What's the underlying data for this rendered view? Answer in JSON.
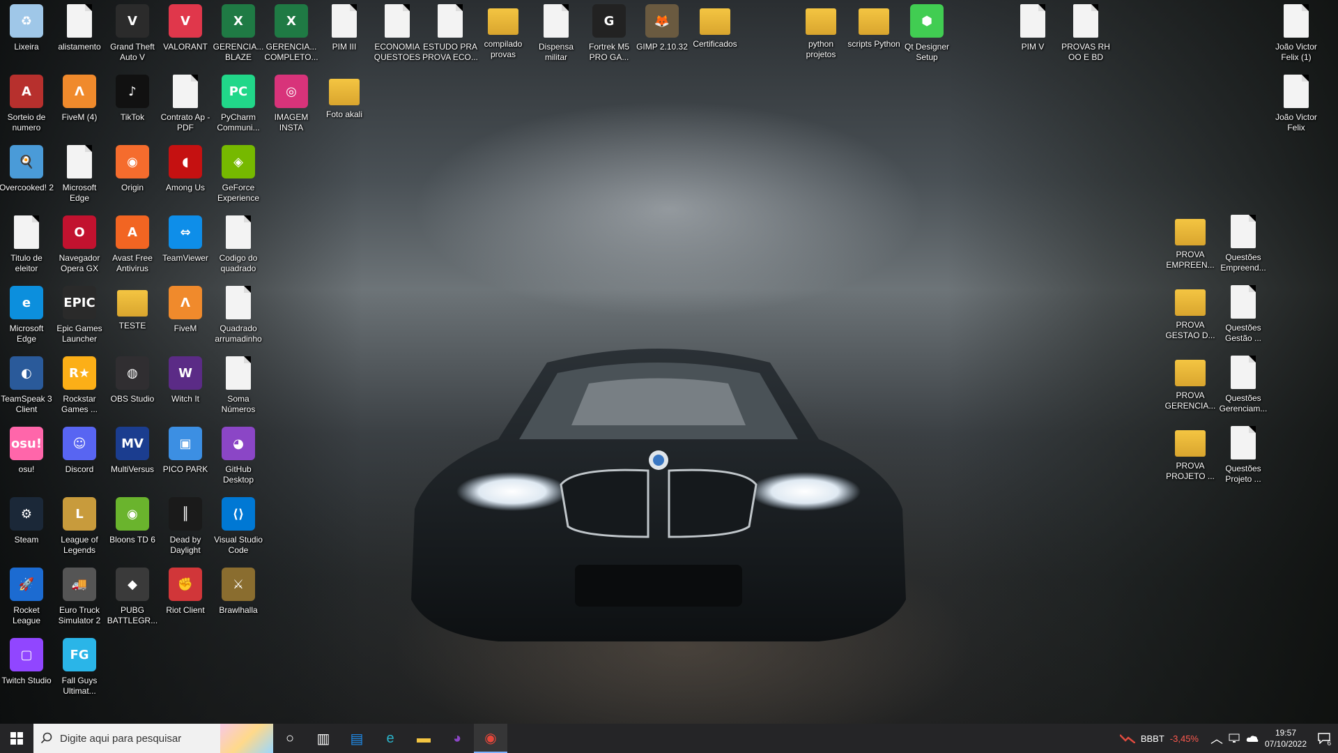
{
  "desktop": {
    "icons_left": [
      {
        "label": "Lixeira",
        "icon": "recycle-bin-icon",
        "type": "app",
        "color": "#9fc7e8"
      },
      {
        "label": "alistamento",
        "icon": "document-icon",
        "type": "doc",
        "color": "#f3f3f3"
      },
      {
        "label": "Grand Theft Auto V",
        "icon": "gta-v-icon",
        "type": "app",
        "color": "#2b2b2b"
      },
      {
        "label": "VALORANT",
        "icon": "valorant-icon",
        "type": "app",
        "color": "#e0374b"
      },
      {
        "label": "GERENCIA... BLAZE",
        "icon": "excel-icon",
        "type": "app",
        "color": "#1f7a44"
      },
      {
        "label": "GERENCIA... COMPLETO...",
        "icon": "excel-icon",
        "type": "app",
        "color": "#1f7a44"
      },
      {
        "label": "PIM III",
        "icon": "document-icon",
        "type": "doc",
        "color": "#f3f3f3"
      },
      {
        "label": "ECONOMIA QUESTOES",
        "icon": "document-icon",
        "type": "doc",
        "color": "#f3f3f3"
      },
      {
        "label": "ESTUDO PRA PROVA ECO...",
        "icon": "document-icon",
        "type": "doc",
        "color": "#f3f3f3"
      },
      {
        "label": "compilado provas",
        "icon": "folder-icon",
        "type": "folder",
        "color": "#f4c542"
      },
      {
        "label": "Dispensa militar",
        "icon": "document-icon",
        "type": "doc",
        "color": "#f3f3f3"
      },
      {
        "label": "Fortrek M5 PRO GA...",
        "icon": "fortrek-icon",
        "type": "app",
        "color": "#222222"
      },
      {
        "label": "GIMP 2.10.32",
        "icon": "gimp-icon",
        "type": "app",
        "color": "#6a5a40"
      },
      {
        "label": "Certificados",
        "icon": "folder-icon",
        "type": "folder",
        "color": "#f4c542"
      },
      {
        "label": "Sorteio de numero",
        "icon": "access-icon",
        "type": "app",
        "color": "#b7302d"
      },
      {
        "label": "FiveM (4)",
        "icon": "fivem-icon",
        "type": "app",
        "color": "#f08a2c"
      },
      {
        "label": "TikTok",
        "icon": "tiktok-icon",
        "type": "app",
        "color": "#111111"
      },
      {
        "label": "Contrato Ap - PDF",
        "icon": "document-icon",
        "type": "doc",
        "color": "#f3f3f3"
      },
      {
        "label": "PyCharm Communi...",
        "icon": "pycharm-icon",
        "type": "app",
        "color": "#21d789"
      },
      {
        "label": "IMAGEM INSTA",
        "icon": "instagram-icon",
        "type": "app",
        "color": "#d8337a"
      },
      {
        "label": "Foto akali",
        "icon": "folder-icon",
        "type": "folder",
        "color": "#f4c542"
      },
      {
        "label": "Overcooked! 2",
        "icon": "overcooked-icon",
        "type": "app",
        "color": "#4a9bd8"
      },
      {
        "label": "Microsoft Edge",
        "icon": "document-icon",
        "type": "doc",
        "color": "#f3f3f3"
      },
      {
        "label": "Origin",
        "icon": "origin-icon",
        "type": "app",
        "color": "#f56c2d"
      },
      {
        "label": "Among Us",
        "icon": "among-us-icon",
        "type": "app",
        "color": "#c51111"
      },
      {
        "label": "GeForce Experience",
        "icon": "nvidia-icon",
        "type": "app",
        "color": "#76b900"
      },
      {
        "label": "Titulo de eleitor",
        "icon": "word-doc-icon",
        "type": "doc",
        "color": "#f3f3f3"
      },
      {
        "label": "Navegador Opera GX",
        "icon": "opera-gx-icon",
        "type": "app",
        "color": "#c2122f"
      },
      {
        "label": "Avast Free Antivirus",
        "icon": "avast-icon",
        "type": "app",
        "color": "#f26522"
      },
      {
        "label": "TeamViewer",
        "icon": "teamviewer-icon",
        "type": "app",
        "color": "#0e8ee9"
      },
      {
        "label": "Codigo do quadrado",
        "icon": "document-icon",
        "type": "doc",
        "color": "#f3f3f3"
      },
      {
        "label": "Microsoft Edge",
        "icon": "edge-icon",
        "type": "app",
        "color": "#0c8fdd"
      },
      {
        "label": "Epic Games Launcher",
        "icon": "epic-games-icon",
        "type": "app",
        "color": "#2a2a2a"
      },
      {
        "label": "TESTE",
        "icon": "chrome-folder-icon",
        "type": "folder",
        "color": "#f4c542"
      },
      {
        "label": "FiveM",
        "icon": "fivem-icon",
        "type": "app",
        "color": "#f08a2c"
      },
      {
        "label": "Quadrado arrumadinho",
        "icon": "document-icon",
        "type": "doc",
        "color": "#f3f3f3"
      },
      {
        "label": "TeamSpeak 3 Client",
        "icon": "teamspeak-icon",
        "type": "app",
        "color": "#2a5a9a"
      },
      {
        "label": "Rockstar Games ...",
        "icon": "rockstar-icon",
        "type": "app",
        "color": "#fcaf17"
      },
      {
        "label": "OBS Studio",
        "icon": "obs-icon",
        "type": "app",
        "color": "#302e31"
      },
      {
        "label": "Witch It",
        "icon": "witch-it-icon",
        "type": "app",
        "color": "#5b2b86"
      },
      {
        "label": "Soma Números",
        "icon": "document-icon",
        "type": "doc",
        "color": "#f3f3f3"
      },
      {
        "label": "osu!",
        "icon": "osu-icon",
        "type": "app",
        "color": "#ff66aa"
      },
      {
        "label": "Discord",
        "icon": "discord-icon",
        "type": "app",
        "color": "#5865f2"
      },
      {
        "label": "MultiVersus",
        "icon": "multiversus-icon",
        "type": "app",
        "color": "#1b3d8f"
      },
      {
        "label": "PICO PARK",
        "icon": "pico-park-icon",
        "type": "app",
        "color": "#3c8fe3"
      },
      {
        "label": "GitHub Desktop",
        "icon": "github-icon",
        "type": "app",
        "color": "#8b46c6"
      },
      {
        "label": "Steam",
        "icon": "steam-icon",
        "type": "app",
        "color": "#1b2838"
      },
      {
        "label": "League of Legends",
        "icon": "league-icon",
        "type": "app",
        "color": "#c89b3c"
      },
      {
        "label": "Bloons TD 6",
        "icon": "bloons-icon",
        "type": "app",
        "color": "#6ab42d"
      },
      {
        "label": "Dead by Daylight",
        "icon": "dbd-icon",
        "type": "app",
        "color": "#1a1a1a"
      },
      {
        "label": "Visual Studio Code",
        "icon": "vscode-icon",
        "type": "app",
        "color": "#0078d4"
      },
      {
        "label": "Rocket League",
        "icon": "rocket-league-icon",
        "type": "app",
        "color": "#1c6bd1"
      },
      {
        "label": "Euro Truck Simulator 2",
        "icon": "ets2-icon",
        "type": "app",
        "color": "#555555"
      },
      {
        "label": "PUBG BATTLEGR...",
        "icon": "pubg-icon",
        "type": "app",
        "color": "#3a3a3a"
      },
      {
        "label": "Riot Client",
        "icon": "riot-icon",
        "type": "app",
        "color": "#d13639"
      },
      {
        "label": "Brawlhalla",
        "icon": "brawlhalla-icon",
        "type": "app",
        "color": "#8a6d2f"
      },
      {
        "label": "Twitch Studio",
        "icon": "twitch-icon",
        "type": "app",
        "color": "#9146ff"
      },
      {
        "label": "Fall Guys Ultimat...",
        "icon": "fall-guys-icon",
        "type": "app",
        "color": "#2ab5e8"
      }
    ],
    "icons_top_right": [
      {
        "label": "python projetos",
        "icon": "folder-icon",
        "type": "folder",
        "color": "#f4c542"
      },
      {
        "label": "scripts Python",
        "icon": "folder-icon",
        "type": "folder",
        "color": "#f4c542"
      },
      {
        "label": "Qt Designer Setup",
        "icon": "qt-setup-icon",
        "type": "app",
        "color": "#41cd52"
      },
      {
        "label": "PIM V",
        "icon": "word-doc-icon",
        "type": "doc",
        "color": "#f3f3f3"
      },
      {
        "label": "PROVAS RH OO E BD",
        "icon": "document-icon",
        "type": "doc",
        "color": "#f3f3f3"
      },
      {
        "label": "João Victor Felix (1)",
        "icon": "word-doc-icon",
        "type": "doc",
        "color": "#f3f3f3"
      },
      {
        "label": "João Victor Felix",
        "icon": "word-doc-icon",
        "type": "doc",
        "color": "#f3f3f3"
      }
    ],
    "icons_right": [
      {
        "label": "PROVA EMPREEN...",
        "icon": "archive-folder-icon",
        "type": "folder",
        "color": "#f4c542"
      },
      {
        "label": "Questões Empreend...",
        "icon": "document-icon",
        "type": "doc",
        "color": "#f3f3f3"
      },
      {
        "label": "PROVA GESTAO D...",
        "icon": "archive-folder-icon",
        "type": "folder",
        "color": "#f4c542"
      },
      {
        "label": "Questões Gestão ...",
        "icon": "document-icon",
        "type": "doc",
        "color": "#f3f3f3"
      },
      {
        "label": "PROVA GERENCIA...",
        "icon": "archive-folder-icon",
        "type": "folder",
        "color": "#f4c542"
      },
      {
        "label": "Questões Gerenciam...",
        "icon": "document-icon",
        "type": "doc",
        "color": "#f3f3f3"
      },
      {
        "label": "PROVA PROJETO ...",
        "icon": "archive-folder-icon",
        "type": "folder",
        "color": "#f4c542"
      },
      {
        "label": "Questões Projeto ...",
        "icon": "document-icon",
        "type": "doc",
        "color": "#f3f3f3"
      }
    ]
  },
  "taskbar": {
    "search_placeholder": "Digite aqui para pesquisar",
    "pinned": [
      {
        "icon": "cortana-icon"
      },
      {
        "icon": "task-view-icon"
      },
      {
        "icon": "microsoft-store-icon"
      },
      {
        "icon": "edge-icon"
      },
      {
        "icon": "file-explorer-icon"
      },
      {
        "icon": "github-icon"
      },
      {
        "icon": "chrome-icon"
      }
    ],
    "stock": {
      "ticker": "BBBT",
      "change": "-3,45%",
      "change_color": "#ff5a4f"
    },
    "clock": {
      "time": "19:57",
      "date": "07/10/2022"
    },
    "notifications_count": "6"
  }
}
